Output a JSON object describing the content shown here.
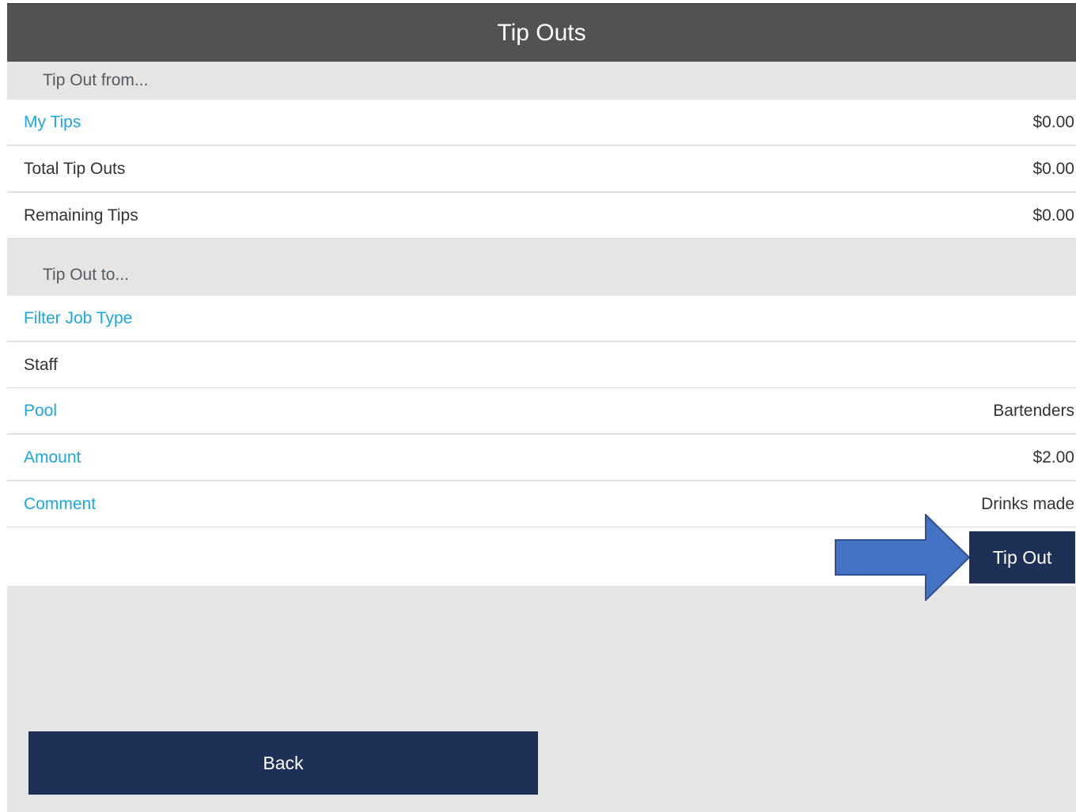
{
  "header": {
    "title": "Tip Outs"
  },
  "from_section": {
    "title": "Tip Out from...",
    "rows": [
      {
        "label": "My Tips",
        "value": "$0.00"
      },
      {
        "label": "Total Tip Outs",
        "value": "$0.00"
      },
      {
        "label": "Remaining Tips",
        "value": "$0.00"
      }
    ]
  },
  "to_section": {
    "title": "Tip Out to...",
    "rows": [
      {
        "label": "Filter Job Type",
        "value": ""
      },
      {
        "label": "Staff",
        "value": ""
      },
      {
        "label": "Pool",
        "value": "Bartenders"
      },
      {
        "label": "Amount",
        "value": "$2.00"
      },
      {
        "label": "Comment",
        "value": "Drinks made"
      }
    ]
  },
  "buttons": {
    "tip_out": "Tip Out",
    "back": "Back"
  },
  "colors": {
    "header_bg": "#525252",
    "link": "#1ba7e0",
    "button_bg": "#1f3056",
    "annotation_arrow": "#4472c4",
    "background": "#e5e5e5"
  }
}
